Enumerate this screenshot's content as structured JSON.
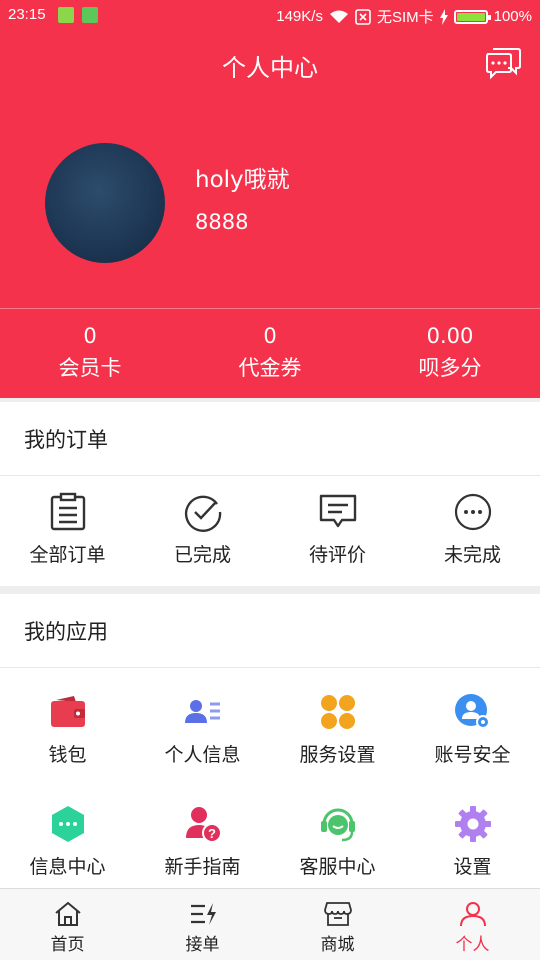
{
  "status_bar": {
    "time": "23:15",
    "network_speed": "149K/s",
    "sim": "无SIM卡",
    "battery": "100%"
  },
  "header": {
    "title": "个人中心",
    "username": "holy哦就",
    "user_id": "8888",
    "stats": [
      {
        "value": "0",
        "label": "会员卡"
      },
      {
        "value": "0",
        "label": "代金券"
      },
      {
        "value": "0.00",
        "label": "呗多分"
      }
    ]
  },
  "orders": {
    "title": "我的订单",
    "items": [
      {
        "label": "全部订单",
        "icon": "clipboard-icon"
      },
      {
        "label": "已完成",
        "icon": "check-circle-icon"
      },
      {
        "label": "待评价",
        "icon": "comment-icon"
      },
      {
        "label": "未完成",
        "icon": "more-circle-icon"
      }
    ]
  },
  "apps": {
    "title": "我的应用",
    "items": [
      {
        "label": "钱包",
        "icon": "wallet-icon",
        "color": "#e83c4f"
      },
      {
        "label": "个人信息",
        "icon": "user-card-icon",
        "color": "#5b6fe6"
      },
      {
        "label": "服务设置",
        "icon": "clover-icon",
        "color": "#f2a41f"
      },
      {
        "label": "账号安全",
        "icon": "account-security-icon",
        "color": "#3a8ff0"
      },
      {
        "label": "信息中心",
        "icon": "message-hexagon-icon",
        "color": "#2bd39b"
      },
      {
        "label": "新手指南",
        "icon": "user-help-icon",
        "color": "#e0305b"
      },
      {
        "label": "客服中心",
        "icon": "headset-icon",
        "color": "#4cc46b"
      },
      {
        "label": "设置",
        "icon": "gear-icon",
        "color": "#b07ff0"
      }
    ]
  },
  "tabbar": {
    "active_color": "#f5324b",
    "items": [
      {
        "label": "首页",
        "icon": "home-icon"
      },
      {
        "label": "接单",
        "icon": "orders-icon"
      },
      {
        "label": "商城",
        "icon": "shop-icon"
      },
      {
        "label": "个人",
        "icon": "person-icon",
        "active": true
      }
    ]
  }
}
